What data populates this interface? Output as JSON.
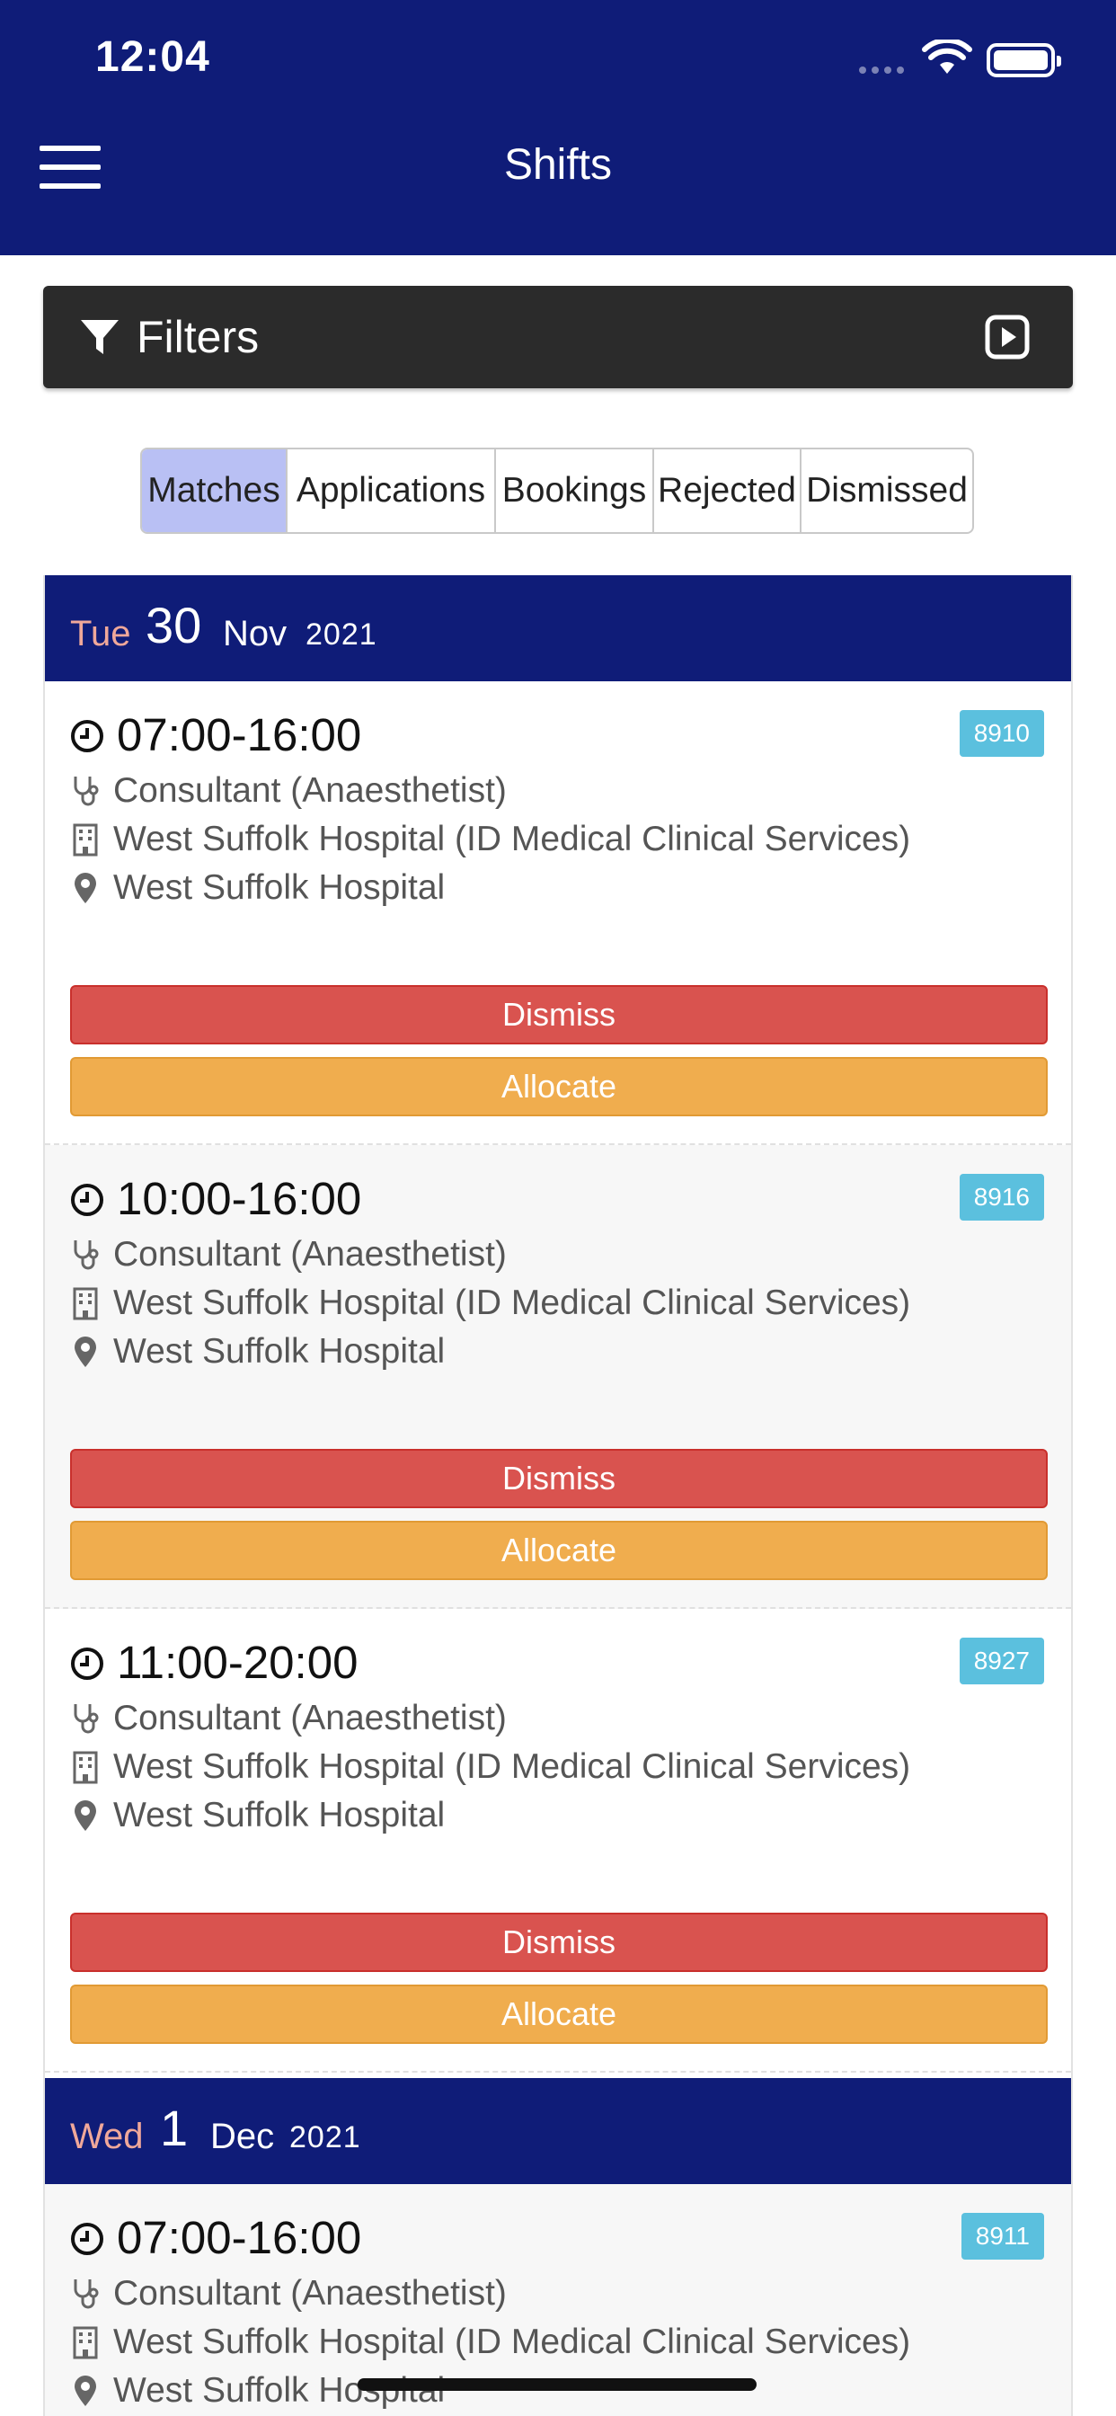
{
  "status_bar": {
    "time": "12:04"
  },
  "header": {
    "title": "Shifts"
  },
  "filters": {
    "label": "Filters"
  },
  "tabs": [
    {
      "label": "Matches",
      "active": true
    },
    {
      "label": "Applications",
      "active": false
    },
    {
      "label": "Bookings",
      "active": false
    },
    {
      "label": "Rejected",
      "active": false
    },
    {
      "label": "Dismissed",
      "active": false
    }
  ],
  "days": [
    {
      "dow": "Tue",
      "day": "30",
      "month": "Nov",
      "year": "2021",
      "shifts": [
        {
          "time": "07:00-16:00",
          "id": "8910",
          "role": "Consultant (Anaesthetist)",
          "org": "West Suffolk Hospital (ID Medical Clinical Services)",
          "location": "West Suffolk Hospital",
          "dismiss": "Dismiss",
          "allocate": "Allocate"
        },
        {
          "time": "10:00-16:00",
          "id": "8916",
          "role": "Consultant (Anaesthetist)",
          "org": "West Suffolk Hospital (ID Medical Clinical Services)",
          "location": "West Suffolk Hospital",
          "dismiss": "Dismiss",
          "allocate": "Allocate"
        },
        {
          "time": "11:00-20:00",
          "id": "8927",
          "role": "Consultant (Anaesthetist)",
          "org": "West Suffolk Hospital (ID Medical Clinical Services)",
          "location": "West Suffolk Hospital",
          "dismiss": "Dismiss",
          "allocate": "Allocate"
        }
      ]
    },
    {
      "dow": "Wed",
      "day": "1",
      "month": "Dec",
      "year": "2021",
      "shifts": [
        {
          "time": "07:00-16:00",
          "id": "8911",
          "role": "Consultant (Anaesthetist)",
          "org": "West Suffolk Hospital (ID Medical Clinical Services)",
          "location": "West Suffolk Hospital"
        }
      ]
    }
  ],
  "colors": {
    "header_bg": "#0f1c78",
    "dismiss": "#d9534f",
    "allocate": "#f0ad4e",
    "badge": "#5bc0de",
    "active_tab": "#b9c0f4",
    "dow": "#f0a89a"
  },
  "icons": [
    "menu-icon",
    "filter-icon",
    "play-icon",
    "clock-icon",
    "stethoscope-icon",
    "building-icon",
    "map-pin-icon"
  ]
}
